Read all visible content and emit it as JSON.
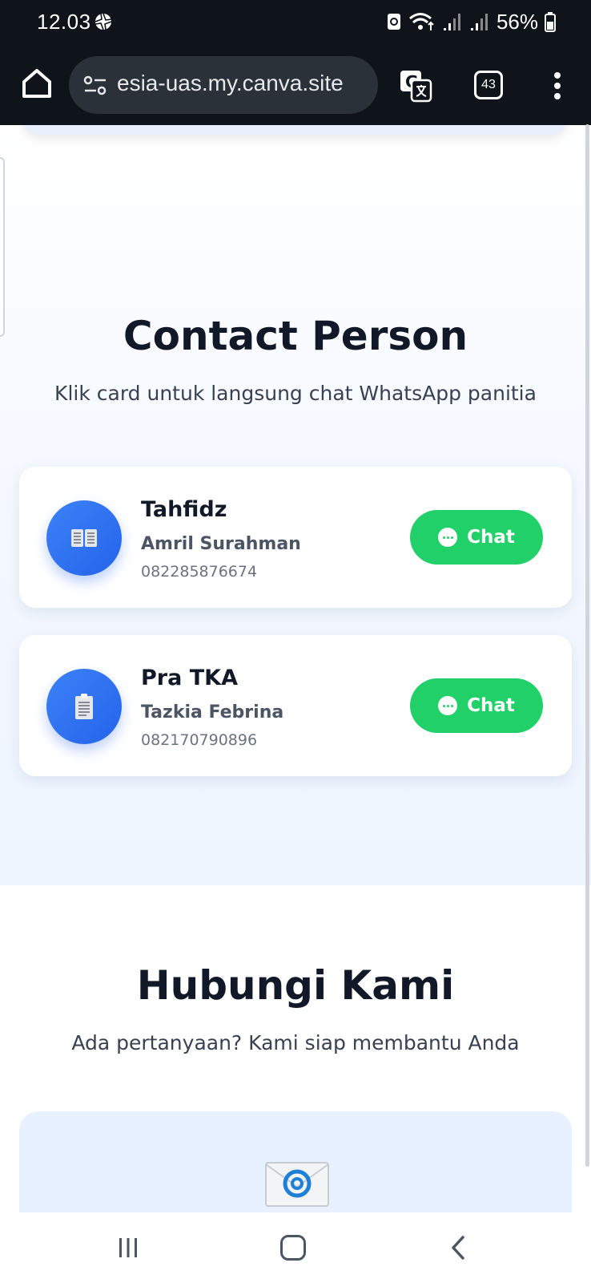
{
  "status_bar": {
    "time": "12.03",
    "battery": "56%"
  },
  "browser": {
    "url": "esia-uas.my.canva.site",
    "tab_count": "43",
    "icons": [
      "home-icon",
      "site-settings-icon",
      "translate-icon",
      "tabs-icon",
      "more-vert-icon"
    ]
  },
  "contact_section": {
    "title": "Contact Person",
    "subtitle": "Klik card untuk langsung chat WhatsApp panitia",
    "cards": [
      {
        "role": "Tahfidz",
        "name": "Amril Surahman",
        "phone": "082285876674",
        "icon": "open-book-icon",
        "button": "Chat"
      },
      {
        "role": "Pra TKA",
        "name": "Tazkia Febrina",
        "phone": "082170790896",
        "icon": "clipboard-icon",
        "button": "Chat"
      }
    ]
  },
  "contact_us": {
    "title": "Hubungi Kami",
    "subtitle": "Ada pertanyaan? Kami siap membantu Anda",
    "icon": "email-envelope-icon"
  },
  "nav_bar": {
    "icons": [
      "recents-icon",
      "home-icon",
      "back-icon"
    ]
  },
  "colors": {
    "chrome_bg": "#0f141a",
    "omnibox_bg": "#2b3138",
    "accent_blue": "#2563eb",
    "whatsapp_green": "#22d06a",
    "title_text": "#111827"
  }
}
